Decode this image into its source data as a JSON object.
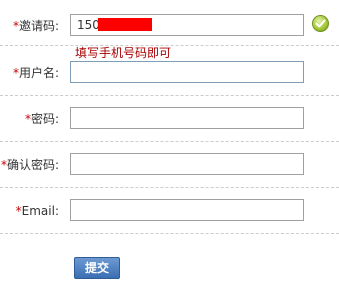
{
  "form": {
    "required_mark": "*",
    "fields": [
      {
        "label": "邀请码:",
        "value": "150",
        "placeholder": ""
      },
      {
        "label": "用户名:",
        "value": "",
        "placeholder": ""
      },
      {
        "label": "密码:",
        "value": "",
        "placeholder": ""
      },
      {
        "label": "确认密码:",
        "value": "",
        "placeholder": ""
      },
      {
        "label": "Email:",
        "value": "",
        "placeholder": ""
      }
    ],
    "invite_hint": "填写手机号码即可",
    "valid_icon": "check-circle-icon",
    "submit_label": "提交"
  },
  "colors": {
    "required": "#cc0000",
    "hint": "#aa0000",
    "submit": "#3a6fb3",
    "valid": "#a7c93a",
    "redaction": "#ff0000"
  }
}
